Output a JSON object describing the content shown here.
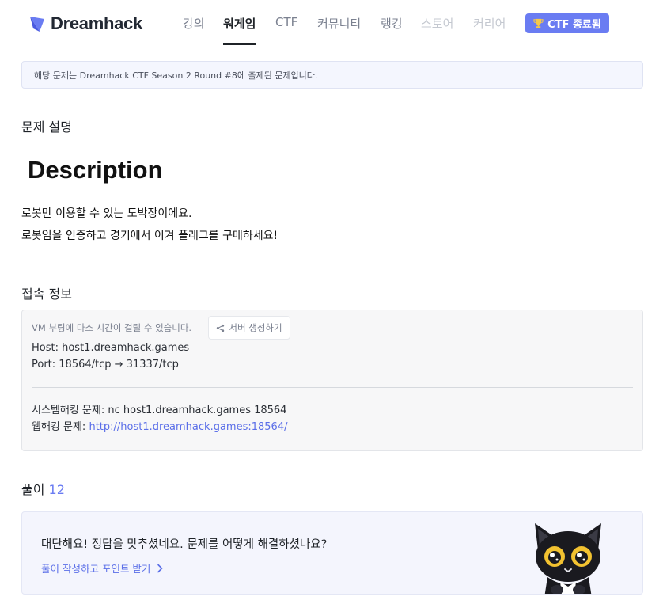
{
  "brand": {
    "name": "Dreamhack",
    "accent": "#6a7cf2"
  },
  "nav": {
    "items": [
      {
        "label": "강의"
      },
      {
        "label": "워게임"
      },
      {
        "label": "CTF"
      },
      {
        "label": "커뮤니티"
      },
      {
        "label": "랭킹"
      },
      {
        "label": "스토어"
      },
      {
        "label": "커리어"
      }
    ],
    "ctf_badge": "CTF 종료됨"
  },
  "notice": {
    "text": "해당 문제는 Dreamhack CTF Season 2 Round #8에 출제된 문제입니다."
  },
  "problem": {
    "section_title": "문제 설명",
    "heading": "Description",
    "lines": [
      "로봇만 이용할 수 있는 도박장이에요.",
      "로봇임을 인증하고 경기에서 이겨 플래그를 구매하세요!"
    ]
  },
  "connection": {
    "section_title": "접속 정보",
    "vm_note": "VM 부팅에 다소 시간이 걸릴 수 있습니다.",
    "server_button": "서버 생성하기",
    "host": "Host: host1.dreamhack.games",
    "port": "Port:  18564/tcp → 31337/tcp",
    "system_hacking_label": "시스템해킹 문제: ",
    "system_hacking_cmd": "nc host1.dreamhack.games 18564",
    "web_hacking_label": "웹해킹 문제: ",
    "web_hacking_url": "http://host1.dreamhack.games:18564/"
  },
  "solutions": {
    "section_title": "풀이",
    "count": "12",
    "question": "대단해요! 정답을 맞추셨네요. 문제를 어떻게 해결하셨나요?",
    "write_link": "풀이 작성하고 포인트 받기"
  }
}
